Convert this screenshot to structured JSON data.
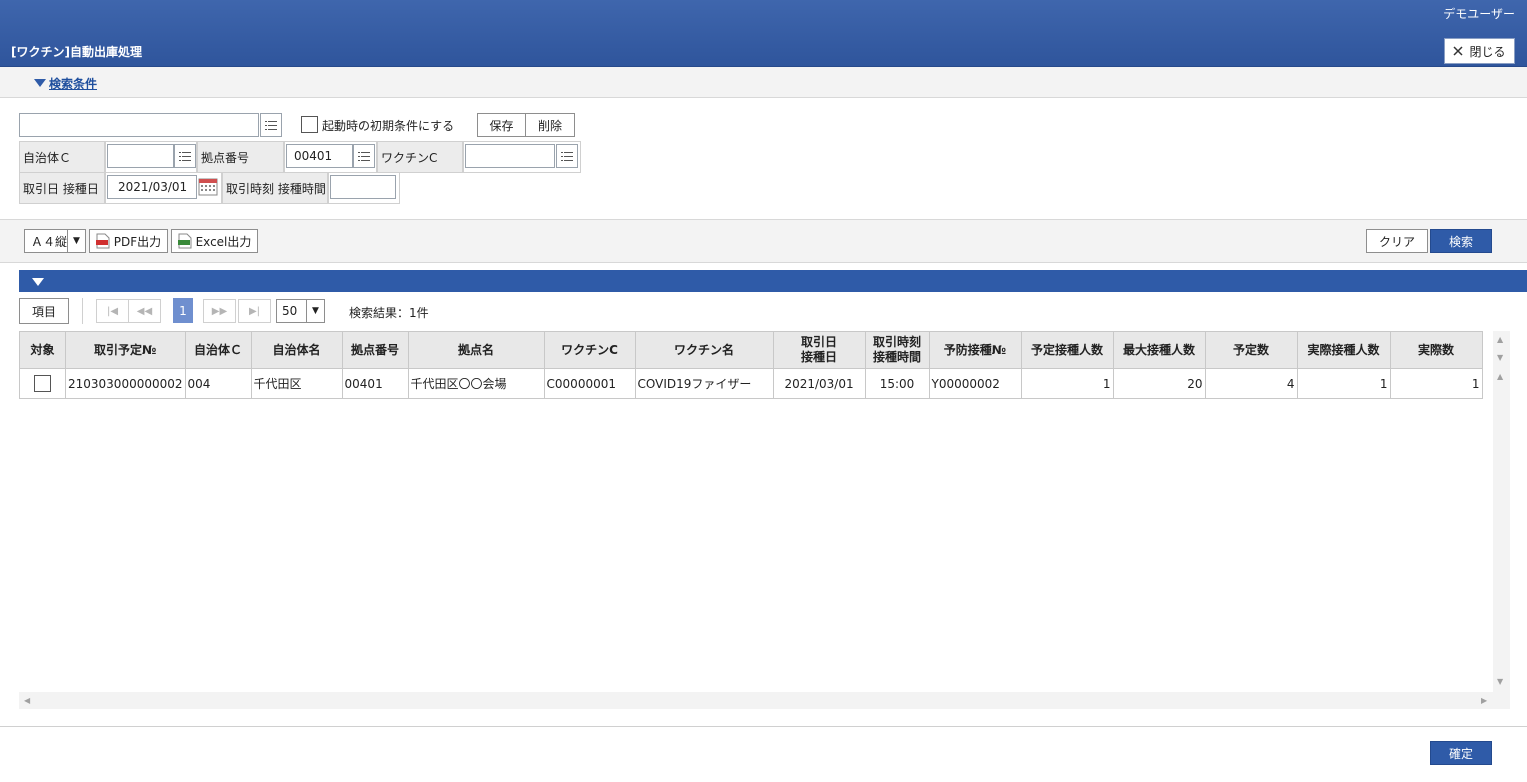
{
  "header": {
    "user": "デモユーザー",
    "title": "[ワクチン]自動出庫処理",
    "close_label": "閉じる"
  },
  "conditions": {
    "toggle_label": "検索条件",
    "preset_value": "",
    "default_check_label": "起動時の初期条件にする",
    "save_label": "保存",
    "delete_label": "削除",
    "municipality_label": "自治体Ｃ",
    "municipality_value": "",
    "site_label": "拠点番号",
    "site_value": "00401",
    "vaccine_label": "ワクチンC",
    "vaccine_value": "",
    "date_label": "取引日 接種日",
    "date_value": "2021/03/01",
    "time_label": "取引時刻 接種時間",
    "time_value": ""
  },
  "toolbar": {
    "paper": "Ａ４縦",
    "pdf_label": "PDF出力",
    "excel_label": "Excel出力",
    "clear_label": "クリア",
    "search_label": "検索"
  },
  "pager": {
    "items_label": "項目",
    "current_page": "1",
    "page_size": "50",
    "result_text": "検索結果：1件"
  },
  "table": {
    "headers": [
      "対象",
      "取引予定№",
      "自治体Ｃ",
      "自治体名",
      "拠点番号",
      "拠点名",
      "ワクチンC",
      "ワクチン名",
      "取引日\n接種日",
      "取引時刻\n接種時間",
      "予防接種№",
      "予定接種人数",
      "最大接種人数",
      "予定数",
      "実際接種人数",
      "実際数"
    ],
    "rows": [
      [
        "",
        "210303000000002",
        "004",
        "千代田区",
        "00401",
        "千代田区〇〇会場",
        "C00000001",
        "COVID19ファイザー",
        "2021/03/01",
        "15:00",
        "Y00000002",
        "1",
        "20",
        "4",
        "1",
        "1"
      ]
    ]
  },
  "footer": {
    "confirm_label": "確定"
  },
  "colors": {
    "header_blue": "#2f5ba8",
    "link_blue": "#1f4f9e"
  }
}
